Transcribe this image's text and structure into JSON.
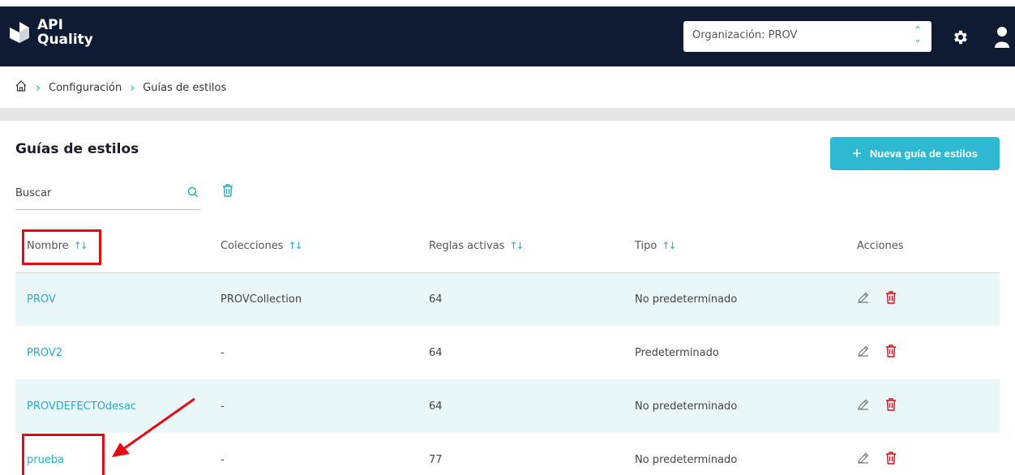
{
  "app": {
    "logo_line1": "API",
    "logo_line2": "Quality"
  },
  "org_select": {
    "value": "Organización: PROV"
  },
  "breadcrumb": {
    "items": [
      "Configuración",
      "Guías de estilos"
    ]
  },
  "page": {
    "title": "Guías de estilos",
    "new_button_label": "Nueva guía de estilos"
  },
  "search": {
    "placeholder": "Buscar"
  },
  "table": {
    "headers": [
      "Nombre",
      "Colecciones",
      "Reglas activas",
      "Tipo",
      "Acciones"
    ],
    "rows": [
      {
        "name": "PROV",
        "collections": "PROVCollection",
        "rules": "64",
        "type": "No predeterminado"
      },
      {
        "name": "PROV2",
        "collections": "-",
        "rules": "64",
        "type": "Predeterminado"
      },
      {
        "name": "PROVDEFECTOdesac",
        "collections": "-",
        "rules": "64",
        "type": "No predeterminado"
      },
      {
        "name": "prueba",
        "collections": "-",
        "rules": "77",
        "type": "No predeterminado"
      }
    ]
  },
  "colors": {
    "header_bg": "#0f1b33",
    "accent": "#2aa9c4",
    "button": "#2fb8d2",
    "row_alt": "#eaf7f9",
    "danger": "#e50914",
    "highlight": "#e50914"
  },
  "icons": {
    "home": "home-icon",
    "gear": "gear-icon",
    "user": "user-icon",
    "search": "search-icon",
    "trash": "trash-icon",
    "edit": "edit-icon",
    "sort": "sort-icon"
  }
}
